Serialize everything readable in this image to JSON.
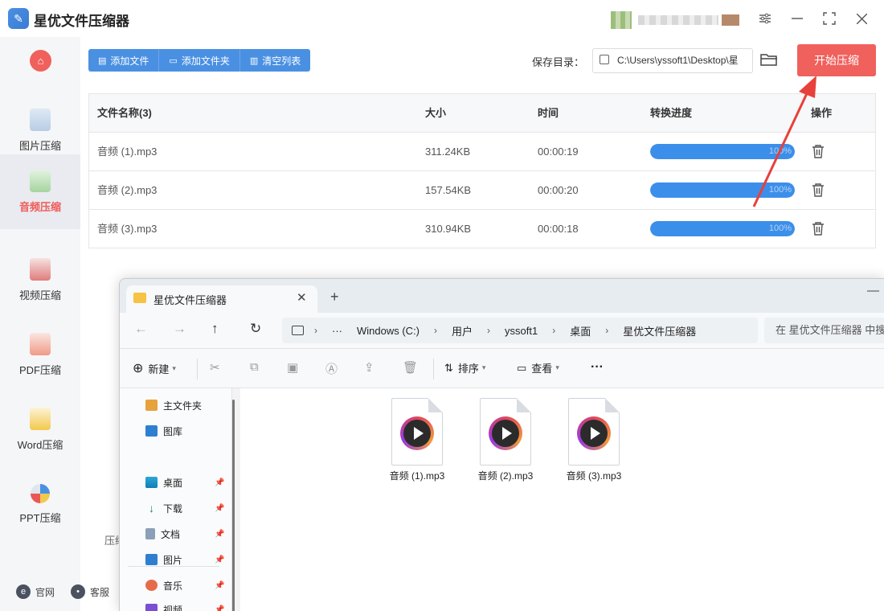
{
  "app": {
    "title": "星优文件压缩器",
    "window_controls": {
      "settings": "⚙",
      "minimize": "—",
      "maximize": "⛶",
      "close": "✕"
    }
  },
  "sidebar": {
    "items": [
      {
        "label": "图片压缩",
        "icon": "image-file-icon",
        "active": false
      },
      {
        "label": "音频压缩",
        "icon": "audio-file-icon",
        "active": true
      },
      {
        "label": "视频压缩",
        "icon": "video-file-icon",
        "active": false
      },
      {
        "label": "PDF压缩",
        "icon": "pdf-file-icon",
        "active": false
      },
      {
        "label": "Word压缩",
        "icon": "word-file-icon",
        "active": false
      },
      {
        "label": "PPT压缩",
        "icon": "ppt-file-icon",
        "active": false
      }
    ],
    "footer": {
      "website": "官网",
      "service": "客服"
    }
  },
  "toolbar": {
    "add_file": "添加文件",
    "add_folder": "添加文件夹",
    "clear_list": "清空列表",
    "save_dir_label": "保存目录：",
    "save_dir_value": "C:\\Users\\yssoft1\\Desktop\\星",
    "start": "开始压缩"
  },
  "table": {
    "headers": {
      "name": "文件名称(3)",
      "size": "大小",
      "time": "时间",
      "progress": "转换进度",
      "action": "操作"
    },
    "rows": [
      {
        "name": "音频 (1).mp3",
        "size": "311.24KB",
        "time": "00:00:19",
        "progress_text": "100%",
        "progress": 100
      },
      {
        "name": "音频 (2).mp3",
        "size": "157.54KB",
        "time": "00:00:20",
        "progress_text": "100%",
        "progress": 100
      },
      {
        "name": "音频 (3).mp3",
        "size": "310.94KB",
        "time": "00:00:18",
        "progress_text": "100%",
        "progress": 100
      }
    ]
  },
  "bottom_label": "压缩",
  "explorer": {
    "tab_title": "星优文件压缩器",
    "breadcrumb": [
      "Windows (C:)",
      "用户",
      "yssoft1",
      "桌面",
      "星优文件压缩器"
    ],
    "breadcrumb_more": "···",
    "search_placeholder": "在 星优文件压缩器 中搜索",
    "commands": {
      "new": "新建",
      "sort": "排序",
      "view": "查看",
      "more": "···"
    },
    "nav": [
      {
        "label": "主文件夹",
        "icon": "home-icon",
        "pinned": false
      },
      {
        "label": "图库",
        "icon": "gallery-icon",
        "pinned": false
      },
      {
        "label": "桌面",
        "icon": "desktop-icon",
        "pinned": true
      },
      {
        "label": "下载",
        "icon": "download-icon",
        "pinned": true
      },
      {
        "label": "文档",
        "icon": "document-icon",
        "pinned": true
      },
      {
        "label": "图片",
        "icon": "pictures-icon",
        "pinned": true
      },
      {
        "label": "音乐",
        "icon": "music-icon",
        "pinned": true
      },
      {
        "label": "视频",
        "icon": "video-icon",
        "pinned": true
      }
    ],
    "files": [
      {
        "name": "音频 (1).mp3"
      },
      {
        "name": "音频 (2).mp3"
      },
      {
        "name": "音频 (3).mp3"
      }
    ]
  },
  "colors": {
    "accent_red": "#f0605c",
    "accent_blue": "#4a90e2",
    "progress_blue": "#3b8fea"
  }
}
